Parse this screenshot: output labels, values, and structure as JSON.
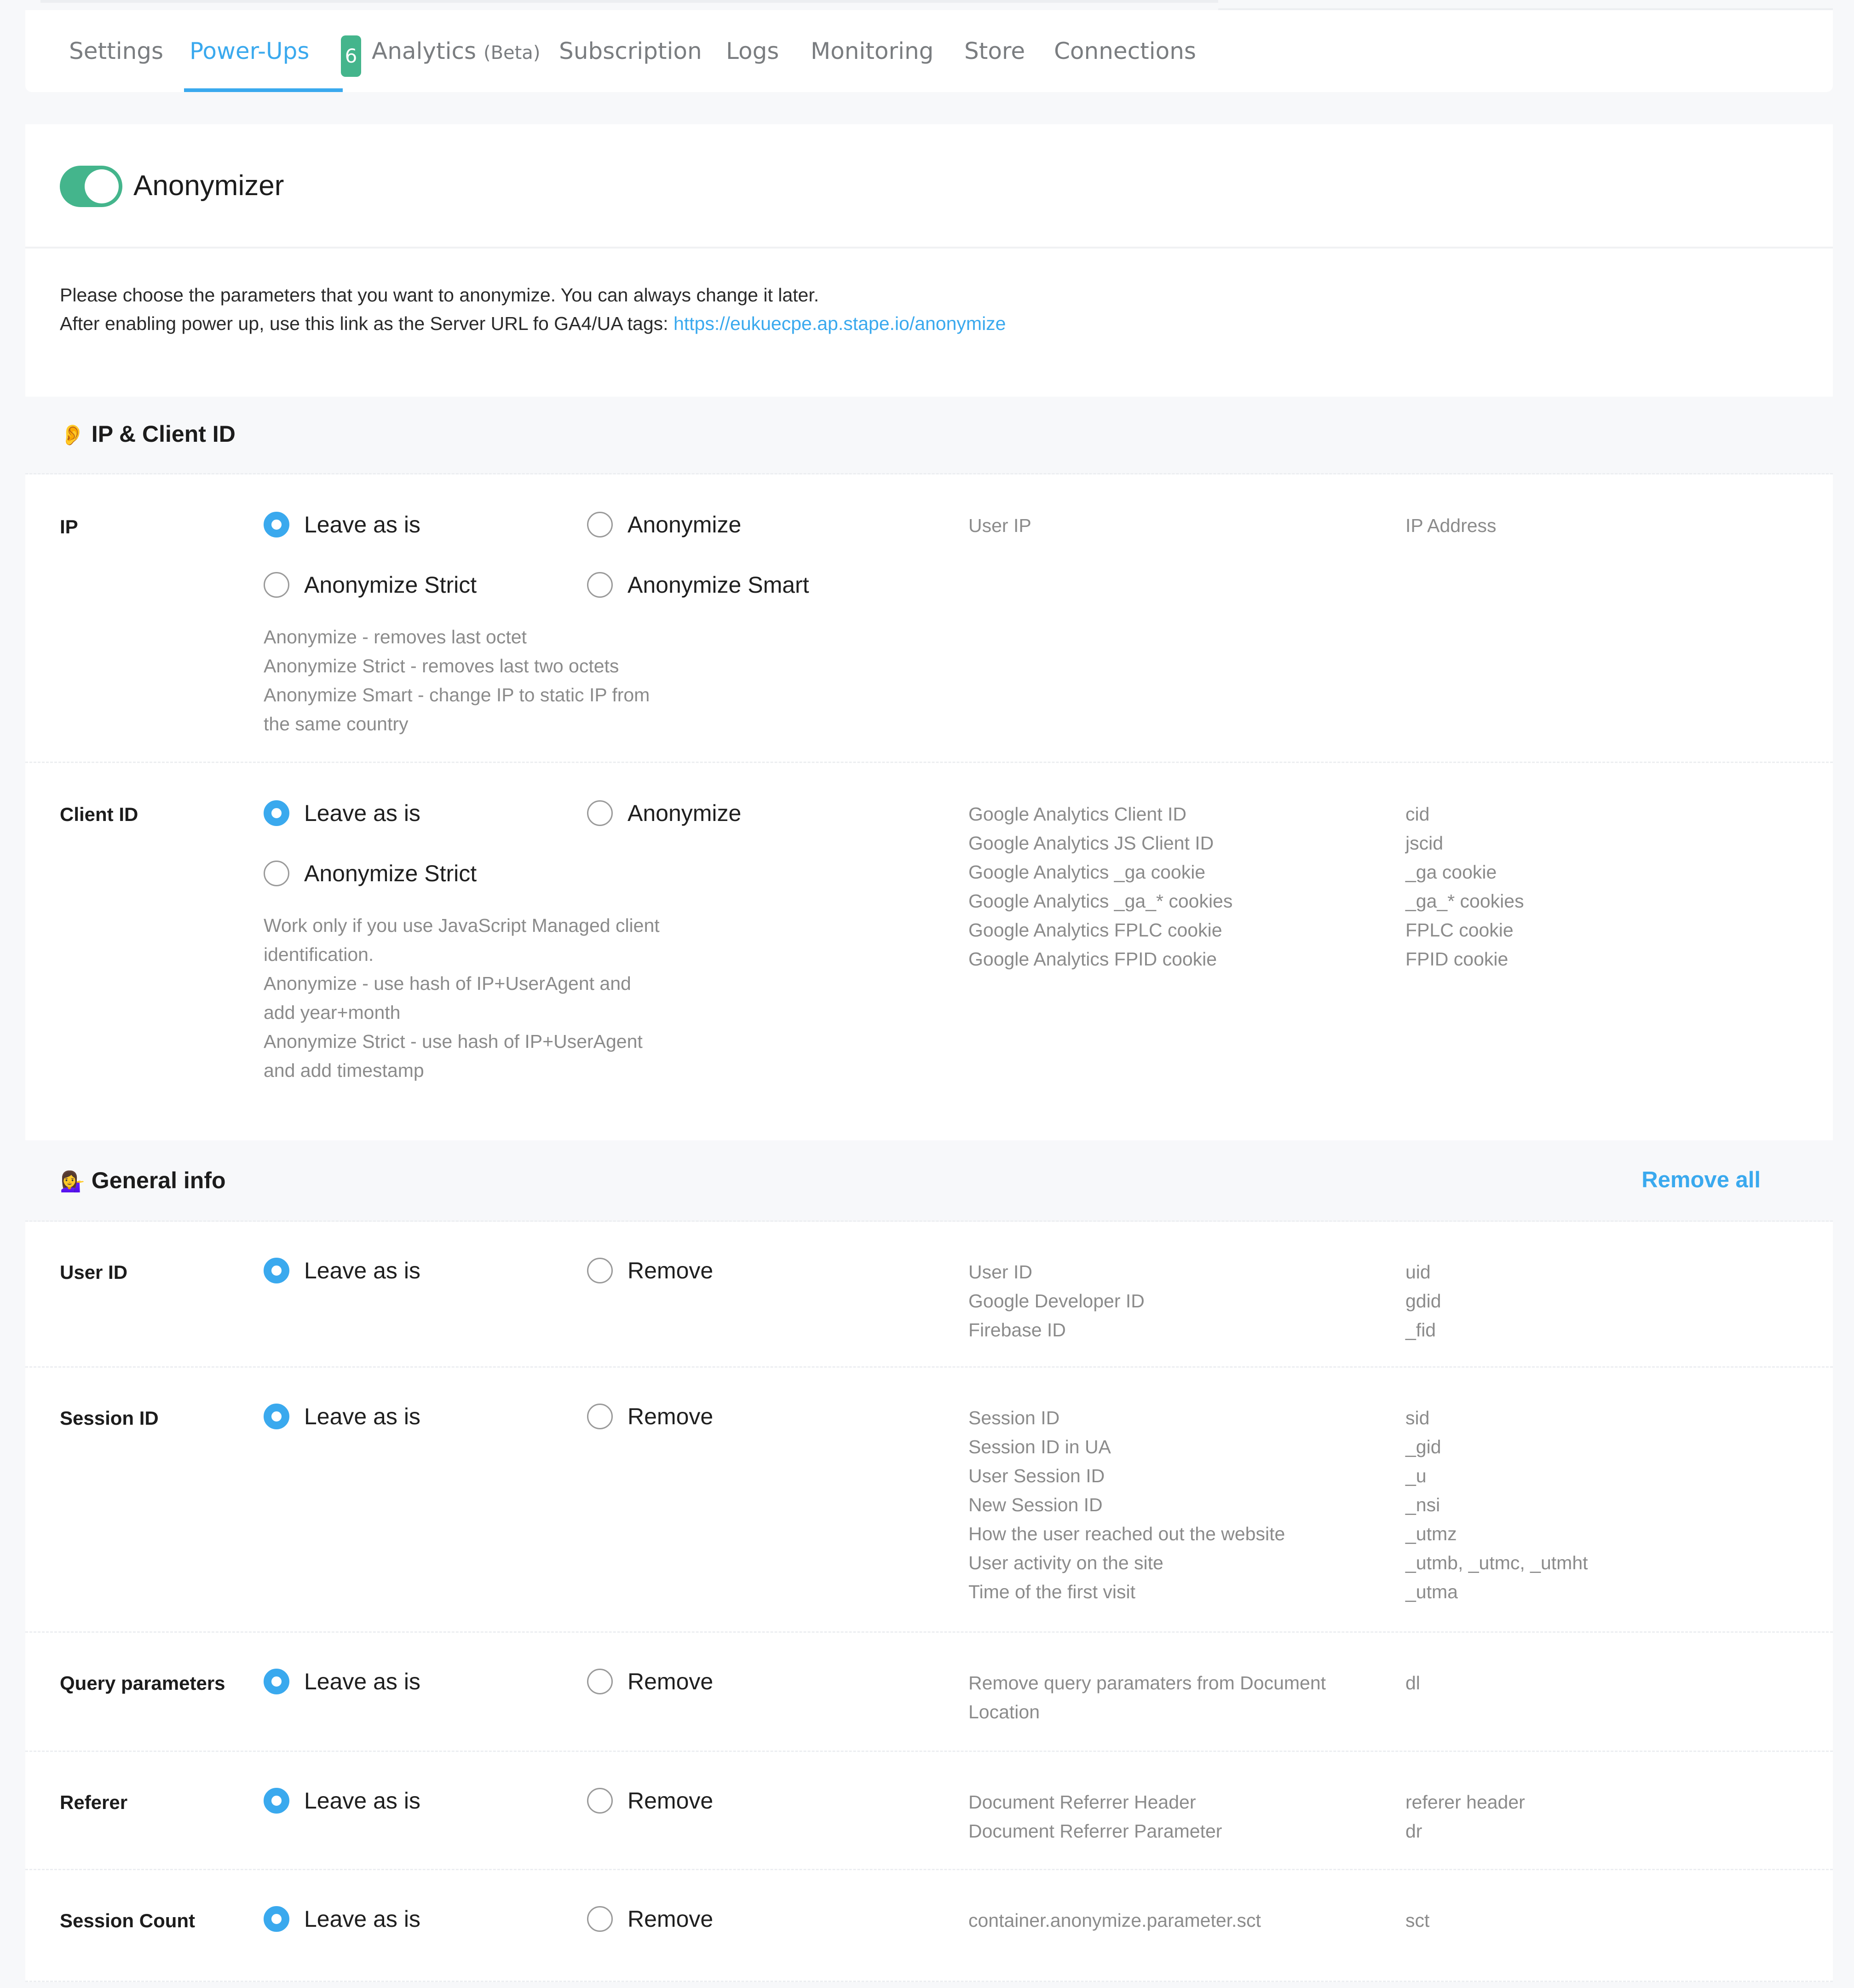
{
  "tabs": [
    {
      "label": "Settings",
      "active": false
    },
    {
      "label": "Power-Ups",
      "active": true,
      "badge": "6"
    },
    {
      "label": "Analytics",
      "suffix": "(Beta)",
      "active": false
    },
    {
      "label": "Subscription",
      "active": false
    },
    {
      "label": "Logs",
      "active": false
    },
    {
      "label": "Monitoring",
      "active": false
    },
    {
      "label": "Store",
      "active": false
    },
    {
      "label": "Connections",
      "active": false
    }
  ],
  "powerup": {
    "title": "Anonymizer",
    "enabled": true,
    "intro_line1": "Please choose the parameters that you want to anonymize. You can always change it later.",
    "intro_line2_prefix": "After enabling power up, use this link as the Server URL fo GA4/UA tags: ",
    "intro_link": "https://eukuecpe.ap.stape.io/anonymize"
  },
  "sections": {
    "ip_client": {
      "emoji": "👂",
      "title": "IP & Client ID",
      "rows": {
        "ip": {
          "label": "IP",
          "options": [
            "Leave as is",
            "Anonymize",
            "Anonymize Strict",
            "Anonymize Smart"
          ],
          "selected": "Leave as is",
          "help": "Anonymize - removes last octet\nAnonymize Strict - removes last two octets\nAnonymize Smart - change IP to static IP from\nthe same country",
          "descriptions": [
            "User IP"
          ],
          "params": [
            "IP Address"
          ]
        },
        "client_id": {
          "label": "Client ID",
          "options": [
            "Leave as is",
            "Anonymize",
            "Anonymize Strict"
          ],
          "selected": "Leave as is",
          "help": "Work only if you use JavaScript Managed client\nidentification.\nAnonymize - use hash of IP+UserAgent and\nadd year+month\nAnonymize Strict - use hash of IP+UserAgent\nand add timestamp",
          "descriptions": [
            "Google Analytics Client ID",
            "Google Analytics JS Client ID",
            "Google Analytics _ga cookie",
            "Google Analytics _ga_* cookies",
            "Google Analytics FPLC cookie",
            "Google Analytics FPID cookie"
          ],
          "params": [
            "cid",
            "jscid",
            "_ga cookie",
            "_ga_* cookies",
            "FPLC cookie",
            "FPID cookie"
          ]
        }
      }
    },
    "general": {
      "emoji": "💁‍♀️",
      "title": "General info",
      "remove_all_label": "Remove all",
      "rows": {
        "user_id": {
          "label": "User ID",
          "options": [
            "Leave as is",
            "Remove"
          ],
          "selected": "Leave as is",
          "descriptions": [
            "User ID",
            "Google Developer ID",
            "Firebase ID"
          ],
          "params": [
            "uid",
            "gdid",
            "_fid"
          ]
        },
        "session_id": {
          "label": "Session ID",
          "options": [
            "Leave as is",
            "Remove"
          ],
          "selected": "Leave as is",
          "descriptions": [
            "Session ID",
            "Session ID in UA",
            "User Session ID",
            "New Session ID",
            "How the user reached out the website",
            "User activity on the site",
            "Time of the first visit"
          ],
          "params": [
            "sid",
            "_gid",
            "_u",
            "_nsi",
            "_utmz",
            "_utmb, _utmc, _utmht",
            "_utma"
          ]
        },
        "query": {
          "label": "Query parameters",
          "options": [
            "Leave as is",
            "Remove"
          ],
          "selected": "Leave as is",
          "descriptions": [
            "Remove query paramaters from Document",
            "Location"
          ],
          "params": [
            "dl"
          ]
        },
        "referer": {
          "label": "Referer",
          "options": [
            "Leave as is",
            "Remove"
          ],
          "selected": "Leave as is",
          "descriptions": [
            "Document Referrer Header",
            "Document Referrer Parameter"
          ],
          "params": [
            "referer header",
            "dr"
          ]
        },
        "session_count": {
          "label": "Session Count",
          "options": [
            "Leave as is",
            "Remove"
          ],
          "selected": "Leave as is",
          "descriptions": [
            "container.anonymize.parameter.sct"
          ],
          "params": [
            "sct"
          ]
        }
      }
    }
  },
  "colors": {
    "accent": "#3aa9ee",
    "toggle_on": "#44b58c",
    "badge": "#44b58c",
    "muted_text": "#8b8b8b"
  }
}
